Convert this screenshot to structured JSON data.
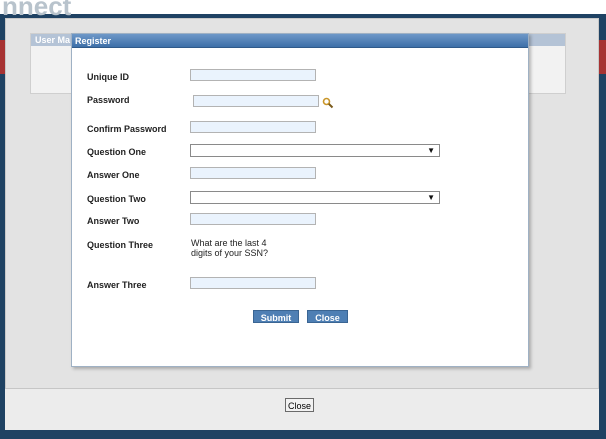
{
  "background": {
    "app_title": "nnect",
    "panel_title": "User Ma",
    "close_label": "Close"
  },
  "dialog": {
    "title": "Register",
    "fields": {
      "unique_id": {
        "label": "Unique ID",
        "value": ""
      },
      "password": {
        "label": "Password",
        "value": ""
      },
      "confirm_password": {
        "label": "Confirm Password",
        "value": ""
      },
      "question_one": {
        "label": "Question One",
        "selected": ""
      },
      "answer_one": {
        "label": "Answer One",
        "value": ""
      },
      "question_two": {
        "label": "Question Two",
        "selected": ""
      },
      "answer_two": {
        "label": "Answer Two",
        "value": ""
      },
      "question_three": {
        "label": "Question Three",
        "text": "What are the last 4 digits of your SSN?"
      },
      "answer_three": {
        "label": "Answer Three",
        "value": ""
      }
    },
    "buttons": {
      "submit": "Submit",
      "close": "Close"
    }
  },
  "icons": {
    "password_lookup": "search-icon",
    "dropdown": "triangle-down-icon"
  },
  "colors": {
    "header_blue": "#3d6fa8",
    "button_blue": "#4e7fb4",
    "input_fill": "#eaf3fd",
    "banner_red": "#a73333",
    "outer_background": "#1f4263"
  }
}
